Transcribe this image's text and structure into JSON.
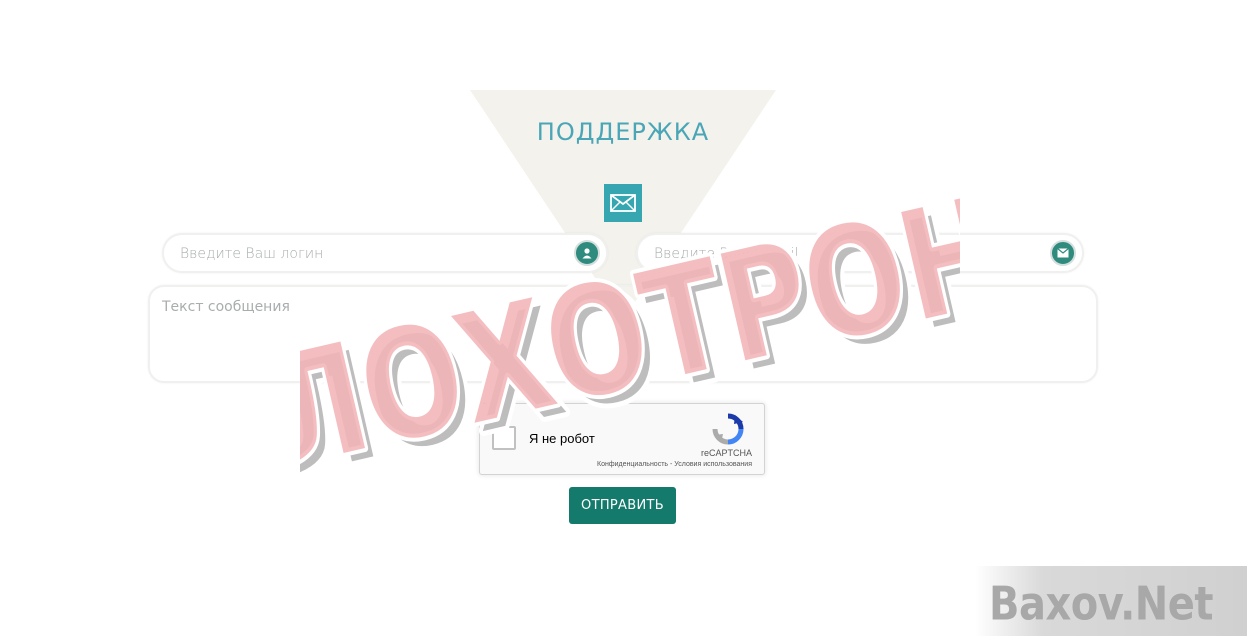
{
  "form": {
    "title": "ПОДДЕРЖКА",
    "login_placeholder": "Введите Ваш логин",
    "email_placeholder": "Введите Ваш E-mail",
    "message_placeholder": "Текст сообщения",
    "submit_label": "ОТПРАВИТЬ"
  },
  "captcha": {
    "label": "Я не робот",
    "brand": "reCAPTCHA",
    "privacy_link": "Конфиденциальность",
    "separator": " - ",
    "terms_link": "Условия использования"
  },
  "overlay": {
    "stamp_text": "ЛОХОТРОН",
    "watermark_text": "Baxov.Net"
  },
  "icons": {
    "header": "envelope-icon",
    "login_field": "user-icon",
    "email_field": "envelope-icon"
  },
  "colors": {
    "accent": "#36a6b0",
    "button": "#137a6c",
    "field_icon": "#2e8b7e",
    "title": "#4aa6b6",
    "triangle": "#f3f2ec",
    "stamp": "#f2b5b8"
  }
}
